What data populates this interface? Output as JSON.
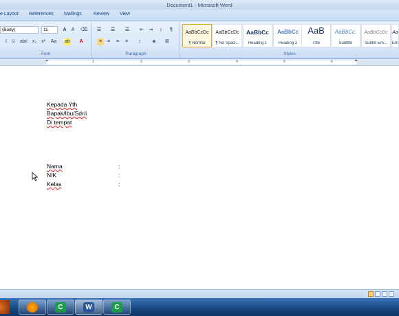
{
  "window": {
    "title": "Document1 - Microsoft Word"
  },
  "tabs": [
    "e Layout",
    "References",
    "Mailings",
    "Review",
    "View"
  ],
  "ribbon": {
    "font_name": "(Body)",
    "font_size": "11",
    "groups": {
      "font": "Font",
      "paragraph": "Paragraph",
      "styles": "Styles"
    },
    "styles": [
      {
        "sample": "AaBbCcDc",
        "name": "¶ Normal",
        "active": true
      },
      {
        "sample": "AaBbCcDc",
        "name": "¶ No Spaci...",
        "active": false
      },
      {
        "sample": "AaBbCc",
        "name": "Heading 1",
        "active": false
      },
      {
        "sample": "AaBbCc",
        "name": "Heading 2",
        "active": false
      },
      {
        "sample": "AaB",
        "name": "Title",
        "active": false
      },
      {
        "sample": "AaBbCc.",
        "name": "Subtitle",
        "active": false
      },
      {
        "sample": "AaBbCcDc",
        "name": "Subtle Em...",
        "active": false
      },
      {
        "sample": "Aa",
        "name": "Em",
        "active": false
      }
    ]
  },
  "ruler": {
    "numbers": [
      "1",
      "2",
      "3",
      "4",
      "5",
      "6"
    ]
  },
  "document": {
    "address_lines": [
      "Kepada Yth",
      "Bapak/Ibu/Sdr/i",
      "Di tempat"
    ],
    "fields": [
      {
        "label": "Nama",
        "sep": ":"
      },
      {
        "label": "NIK",
        "sep": ":"
      },
      {
        "label": "Kelas",
        "sep": ":"
      }
    ]
  },
  "taskbar": {
    "apps": [
      {
        "icon": "firefox-icon",
        "color": "#e66000"
      },
      {
        "icon": "camtasia-icon",
        "color": "#1f9a4b"
      },
      {
        "icon": "word-icon",
        "color": "#2b579a"
      },
      {
        "icon": "camtasia-recorder-icon",
        "color": "#1f9a4b"
      }
    ]
  },
  "colors": {
    "accent": "#1e395b",
    "spell_error": "#dd2222"
  }
}
